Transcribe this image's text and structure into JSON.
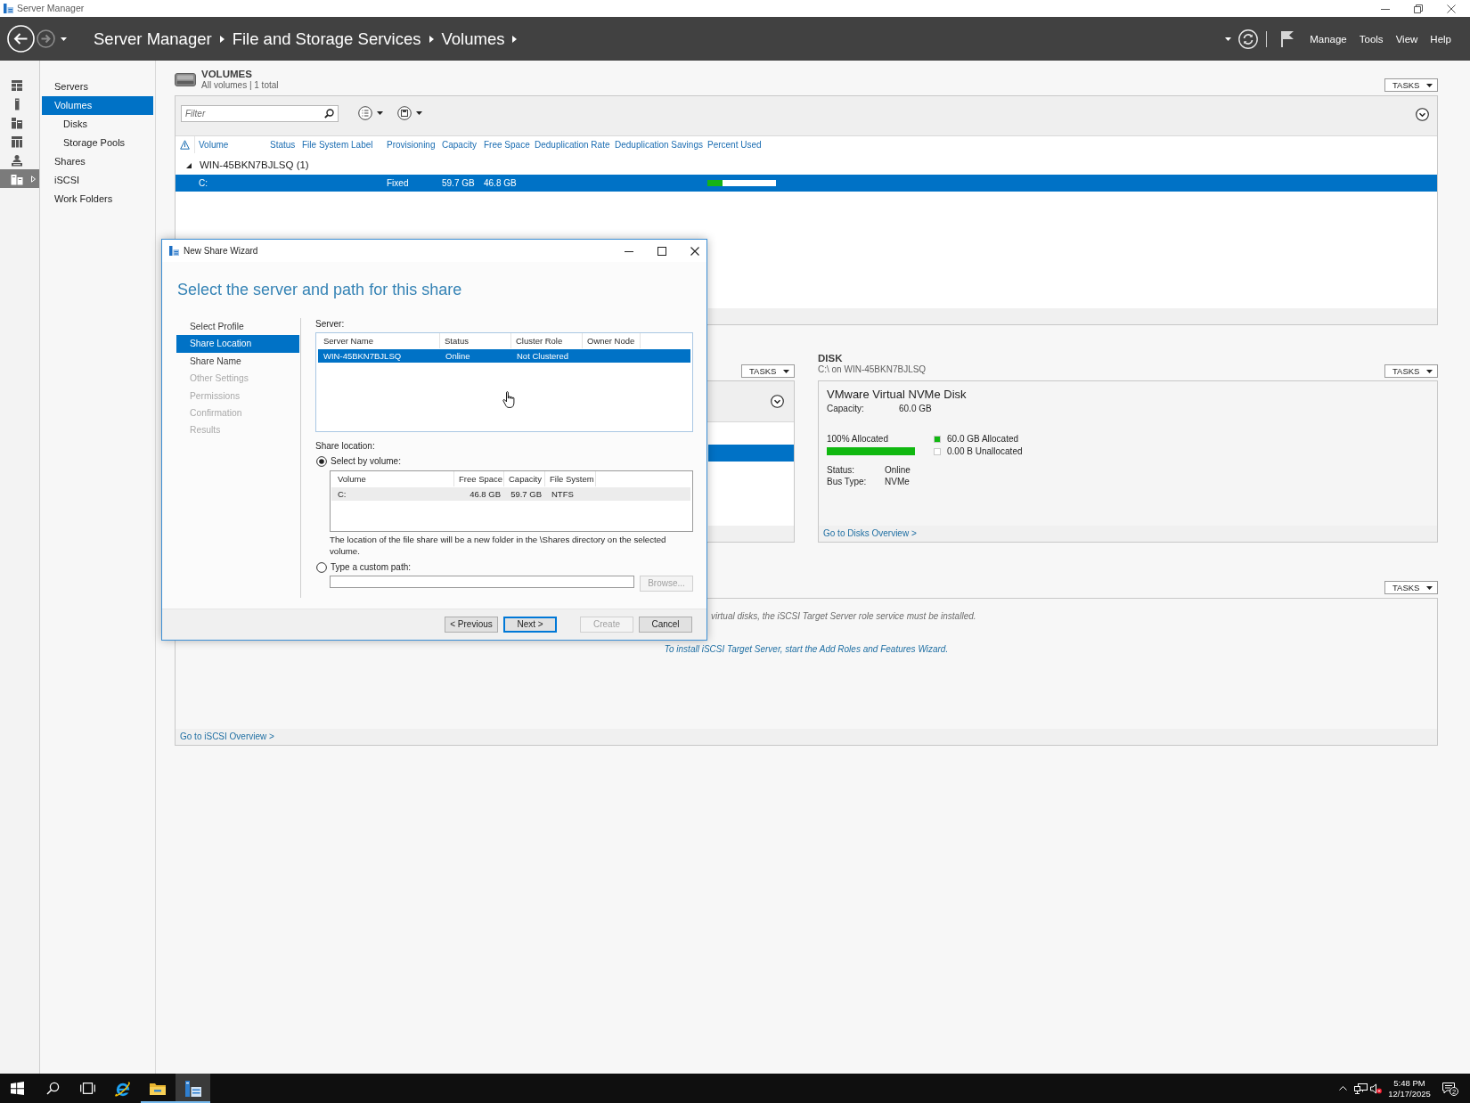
{
  "window": {
    "title": "Server Manager"
  },
  "header": {
    "history": [
      {
        "kind": "back",
        "disabled": false
      },
      {
        "kind": "forward",
        "disabled": true
      }
    ],
    "breadcrumb": [
      "Server Manager",
      "File and Storage Services",
      "Volumes"
    ],
    "menu": [
      "Manage",
      "Tools",
      "View",
      "Help"
    ]
  },
  "rail": [
    {
      "kind": "grid",
      "selected": false
    },
    {
      "kind": "tower",
      "selected": false
    },
    {
      "kind": "servers",
      "selected": false
    },
    {
      "kind": "rack",
      "selected": false
    },
    {
      "kind": "user",
      "selected": false
    },
    {
      "kind": "files",
      "selected": true
    }
  ],
  "nav": [
    {
      "label": "Servers",
      "selected": false
    },
    {
      "label": "Volumes",
      "selected": true,
      "children": [
        {
          "label": "Disks",
          "selected": false
        },
        {
          "label": "Storage Pools",
          "selected": false
        }
      ]
    },
    {
      "label": "Shares",
      "selected": false
    },
    {
      "label": "iSCSI",
      "selected": false
    },
    {
      "label": "Work Folders",
      "selected": false
    }
  ],
  "volumes": {
    "title": "VOLUMES",
    "subtitle": "All volumes | 1 total",
    "tasks": "TASKS",
    "filter": {
      "placeholder": "Filter"
    },
    "columns": [
      "Volume",
      "Status",
      "File System Label",
      "Provisioning",
      "Capacity",
      "Free Space",
      "Deduplication Rate",
      "Deduplication Savings",
      "Percent Used"
    ],
    "groups": [
      {
        "label": "WIN-45BKN7BJLSQ (1)",
        "expanded": true,
        "rows": [
          {
            "selected": true,
            "volume": "C:",
            "provisioning": "Fixed",
            "capacity": "59.7 GB",
            "free_space": "46.8 GB",
            "percent_used": {
              "level": 0.22
            }
          }
        ]
      }
    ]
  },
  "left_panel": {
    "tasks": "TASKS",
    "rows": [
      {
        "selected": true
      }
    ]
  },
  "disk": {
    "title": "DISK",
    "subtitle": "C:\\ on WIN-45BKN7BJLSQ",
    "tasks": "TASKS",
    "name": "VMware Virtual NVMe Disk",
    "capacity": {
      "label": "Capacity:",
      "value": "60.0 GB"
    },
    "allocation": {
      "label": "100% Allocated",
      "level": 1
    },
    "legend": [
      {
        "label": "60.0 GB Allocated",
        "color": "#10b810"
      },
      {
        "label": "0.00 B Unallocated",
        "color": "#ffffff"
      }
    ],
    "properties": [
      {
        "label": "Status:",
        "value": "Online"
      },
      {
        "label": "Bus Type:",
        "value": "NVMe"
      }
    ],
    "footer_link": "Go to Disks Overview >"
  },
  "iscsi": {
    "tasks": "TASKS",
    "message": "virtual disks, the iSCSI Target Server role service must be installed.",
    "link": "To install iSCSI Target Server, start the Add Roles and Features Wizard.",
    "footer_link": "Go to iSCSI Overview >"
  },
  "dialog": {
    "title": "New Share Wizard",
    "heading": "Select the server and path for this share",
    "steps": [
      {
        "label": "Select Profile",
        "selected": false,
        "disabled": false
      },
      {
        "label": "Share Location",
        "selected": true,
        "disabled": false
      },
      {
        "label": "Share Name",
        "selected": false,
        "disabled": false
      },
      {
        "label": "Other Settings",
        "selected": false,
        "disabled": true
      },
      {
        "label": "Permissions",
        "selected": false,
        "disabled": true
      },
      {
        "label": "Confirmation",
        "selected": false,
        "disabled": true
      },
      {
        "label": "Results",
        "selected": false,
        "disabled": true
      }
    ],
    "server_label": "Server:",
    "servers": {
      "columns": [
        "Server Name",
        "Status",
        "Cluster Role",
        "Owner Node"
      ],
      "rows": [
        {
          "selected": true,
          "cells": [
            "WIN-45BKN7BJLSQ",
            "Online",
            "Not Clustered"
          ]
        }
      ]
    },
    "location_label": "Share location:",
    "location_options": [
      {
        "label": "Select by volume:",
        "selected": true
      },
      {
        "label": "Type a custom path:",
        "selected": false
      }
    ],
    "volumes": {
      "columns": [
        "Volume",
        "Free Space",
        "Capacity",
        "File System"
      ],
      "rows": [
        {
          "selected": true,
          "cells": [
            "C:",
            "46.8 GB",
            "59.7 GB",
            "NTFS"
          ]
        }
      ]
    },
    "note": "The location of the file share will be a new folder in the \\Shares directory on the selected volume.",
    "browse": {
      "label": "Browse...",
      "disabled": true
    },
    "buttons": [
      {
        "label": "< Previous",
        "disabled": false,
        "default": false
      },
      {
        "label": "Next >",
        "disabled": false,
        "default": true
      },
      {
        "label": "Create",
        "disabled": true,
        "default": false
      },
      {
        "label": "Cancel",
        "disabled": false,
        "default": false
      }
    ]
  },
  "taskbar": {
    "apps": [
      {
        "kind": "start",
        "running": false,
        "selected": false
      },
      {
        "kind": "search",
        "running": false,
        "selected": false
      },
      {
        "kind": "taskview",
        "running": false,
        "selected": false
      },
      {
        "kind": "browser",
        "running": false,
        "selected": false
      },
      {
        "kind": "explorer",
        "running": true,
        "selected": false
      },
      {
        "kind": "servermanager",
        "running": true,
        "selected": true
      }
    ],
    "time": "5:48 PM",
    "date": "12/17/2025",
    "notifications": "2"
  }
}
